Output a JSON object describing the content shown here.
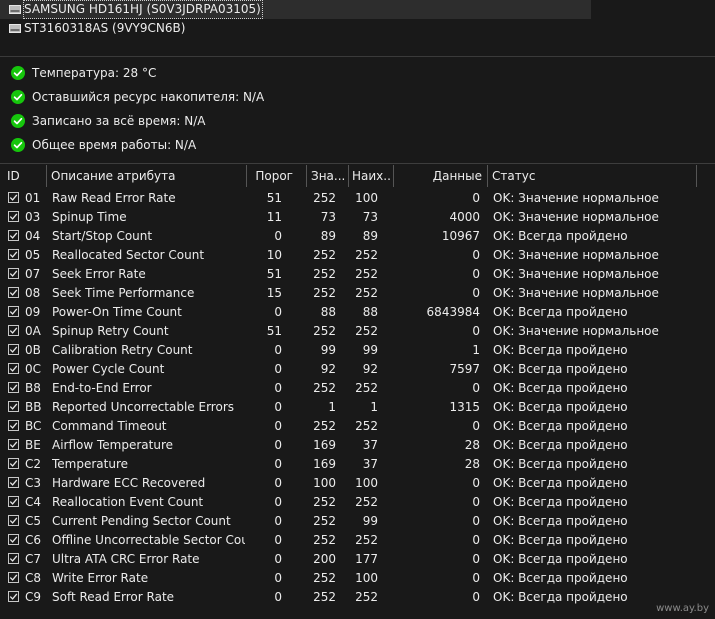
{
  "drives": [
    {
      "label": "SAMSUNG HD161HJ (S0V3JDRPA03105)",
      "selected": true
    },
    {
      "label": "ST3160318AS (9VY9CN6B)",
      "selected": false
    }
  ],
  "summary": [
    {
      "label": "Температура: 28 °C",
      "icon": "ok-check-icon"
    },
    {
      "label": "Оставшийся ресурс накопителя: N/A",
      "icon": "ok-check-icon"
    },
    {
      "label": "Записано за всё время: N/A",
      "icon": "ok-check-icon"
    },
    {
      "label": "Общее время работы: N/A",
      "icon": "ok-check-icon"
    }
  ],
  "table": {
    "columns": [
      "ID",
      "Описание атрибута",
      "Порог",
      "Зна...",
      "Наих...",
      "Данные",
      "Статус"
    ],
    "rows": [
      {
        "id": "01",
        "name": "Raw Read Error Rate",
        "threshold": "51",
        "value": "252",
        "worst": "100",
        "data": "0",
        "status": "OK: Значение нормальное"
      },
      {
        "id": "03",
        "name": "Spinup Time",
        "threshold": "11",
        "value": "73",
        "worst": "73",
        "data": "4000",
        "status": "OK: Значение нормальное"
      },
      {
        "id": "04",
        "name": "Start/Stop Count",
        "threshold": "0",
        "value": "89",
        "worst": "89",
        "data": "10967",
        "status": "OK: Всегда пройдено"
      },
      {
        "id": "05",
        "name": "Reallocated Sector Count",
        "threshold": "10",
        "value": "252",
        "worst": "252",
        "data": "0",
        "status": "OK: Значение нормальное"
      },
      {
        "id": "07",
        "name": "Seek Error Rate",
        "threshold": "51",
        "value": "252",
        "worst": "252",
        "data": "0",
        "status": "OK: Значение нормальное"
      },
      {
        "id": "08",
        "name": "Seek Time Performance",
        "threshold": "15",
        "value": "252",
        "worst": "252",
        "data": "0",
        "status": "OK: Значение нормальное"
      },
      {
        "id": "09",
        "name": "Power-On Time Count",
        "threshold": "0",
        "value": "88",
        "worst": "88",
        "data": "6843984",
        "status": "OK: Всегда пройдено"
      },
      {
        "id": "0A",
        "name": "Spinup Retry Count",
        "threshold": "51",
        "value": "252",
        "worst": "252",
        "data": "0",
        "status": "OK: Значение нормальное"
      },
      {
        "id": "0B",
        "name": "Calibration Retry Count",
        "threshold": "0",
        "value": "99",
        "worst": "99",
        "data": "1",
        "status": "OK: Всегда пройдено"
      },
      {
        "id": "0C",
        "name": "Power Cycle Count",
        "threshold": "0",
        "value": "92",
        "worst": "92",
        "data": "7597",
        "status": "OK: Всегда пройдено"
      },
      {
        "id": "B8",
        "name": "End-to-End Error",
        "threshold": "0",
        "value": "252",
        "worst": "252",
        "data": "0",
        "status": "OK: Всегда пройдено"
      },
      {
        "id": "BB",
        "name": "Reported Uncorrectable Errors",
        "threshold": "0",
        "value": "1",
        "worst": "1",
        "data": "1315",
        "status": "OK: Всегда пройдено"
      },
      {
        "id": "BC",
        "name": "Command Timeout",
        "threshold": "0",
        "value": "252",
        "worst": "252",
        "data": "0",
        "status": "OK: Всегда пройдено"
      },
      {
        "id": "BE",
        "name": "Airflow Temperature",
        "threshold": "0",
        "value": "169",
        "worst": "37",
        "data": "28",
        "status": "OK: Всегда пройдено"
      },
      {
        "id": "C2",
        "name": "Temperature",
        "threshold": "0",
        "value": "169",
        "worst": "37",
        "data": "28",
        "status": "OK: Всегда пройдено"
      },
      {
        "id": "C3",
        "name": "Hardware ECC Recovered",
        "threshold": "0",
        "value": "100",
        "worst": "100",
        "data": "0",
        "status": "OK: Всегда пройдено"
      },
      {
        "id": "C4",
        "name": "Reallocation Event Count",
        "threshold": "0",
        "value": "252",
        "worst": "252",
        "data": "0",
        "status": "OK: Всегда пройдено"
      },
      {
        "id": "C5",
        "name": "Current Pending Sector Count",
        "threshold": "0",
        "value": "252",
        "worst": "99",
        "data": "0",
        "status": "OK: Всегда пройдено"
      },
      {
        "id": "C6",
        "name": "Offline Uncorrectable Sector Count",
        "threshold": "0",
        "value": "252",
        "worst": "252",
        "data": "0",
        "status": "OK: Всегда пройдено"
      },
      {
        "id": "C7",
        "name": "Ultra ATA CRC Error Rate",
        "threshold": "0",
        "value": "200",
        "worst": "177",
        "data": "0",
        "status": "OK: Всегда пройдено"
      },
      {
        "id": "C8",
        "name": "Write Error Rate",
        "threshold": "0",
        "value": "252",
        "worst": "100",
        "data": "0",
        "status": "OK: Всегда пройдено"
      },
      {
        "id": "C9",
        "name": "Soft Read Error Rate",
        "threshold": "0",
        "value": "252",
        "worst": "252",
        "data": "0",
        "status": "OK: Всегда пройдено"
      }
    ]
  },
  "watermark": "www.ay.by",
  "colors": {
    "ok_green": "#16c60c",
    "background": "#191919",
    "text": "#ececec"
  }
}
